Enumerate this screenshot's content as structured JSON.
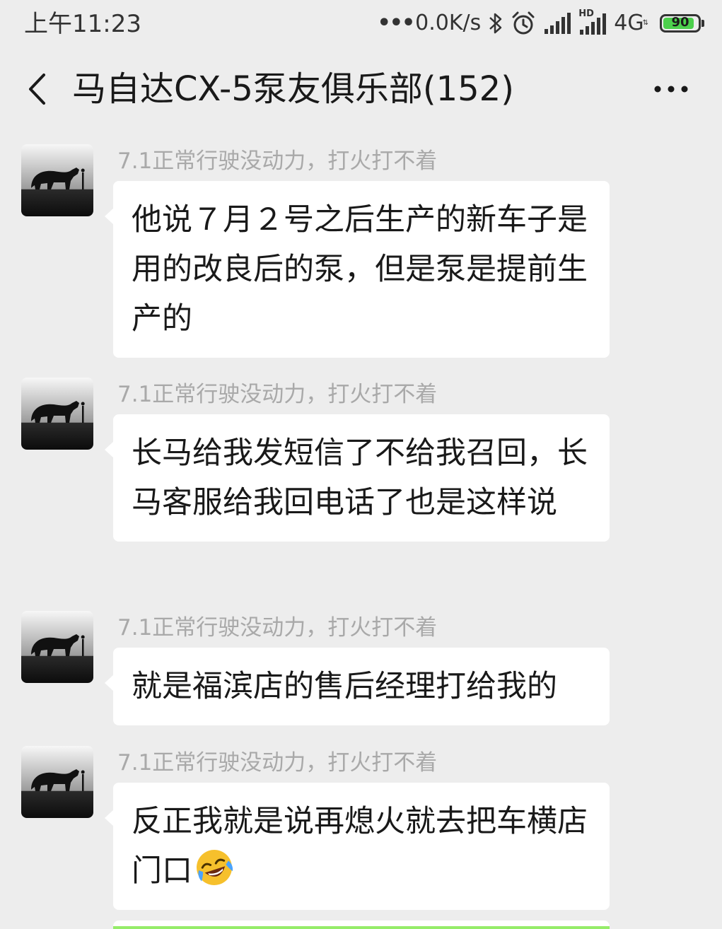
{
  "status_bar": {
    "time": "上午11:23",
    "net_speed": "0.0K/s",
    "hd_label": "HD",
    "network_type": "4G",
    "battery_level": "90",
    "battery_fraction": 0.9,
    "icons": [
      "bluetooth-icon",
      "alarm-icon",
      "signal-icon",
      "signal-hd-icon",
      "battery-icon"
    ],
    "battery_color": "#4cd04c"
  },
  "header": {
    "title": "马自达CX-5泵友俱乐部(152)",
    "back_icon": "chevron-left-icon",
    "more_icon": "more-horizontal-icon"
  },
  "messages": [
    {
      "sender": "7.1正常行驶没动力，打火打不着",
      "text": "他说７月２号之后生产的新车子是用的改良后的泵，但是泵是提前生产的"
    },
    {
      "sender": "7.1正常行驶没动力，打火打不着",
      "text": "长马给我发短信了不给我召回，长马客服给我回电话了也是这样说"
    },
    {
      "sender": "7.1正常行驶没动力，打火打不着",
      "text": "就是福滨店的售后经理打给我的"
    },
    {
      "sender": "7.1正常行驶没动力，打火打不着",
      "text": "反正我就是说再熄火就去把车横店门口",
      "emoji": "laughing-crying-face-icon"
    }
  ],
  "colors": {
    "background": "#ededed",
    "bubble": "#ffffff",
    "sender_name": "#a9a9a9",
    "own_bubble": "#95ec69"
  }
}
